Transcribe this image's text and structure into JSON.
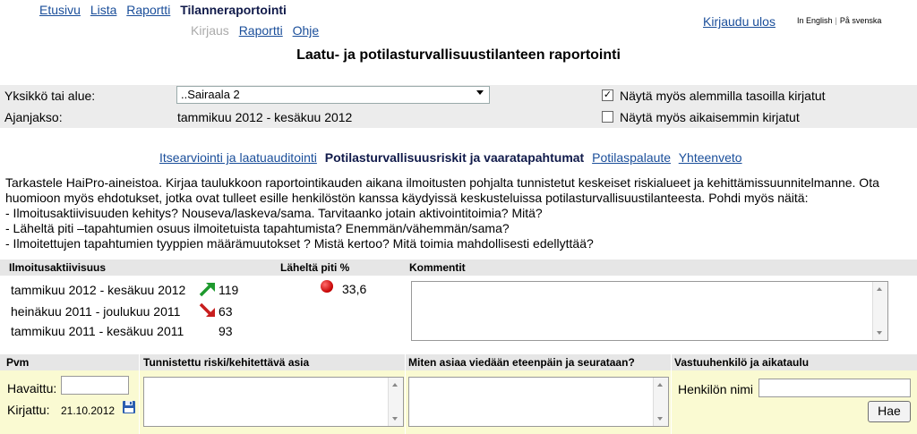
{
  "nav": {
    "primary": [
      "Etusivu",
      "Lista",
      "Raportti",
      "Tilanneraportointi"
    ],
    "secondary": [
      "Kirjaus",
      "Raportti",
      "Ohje"
    ],
    "logout": "Kirjaudu ulos",
    "lang_en": "In English",
    "lang_sep": "|",
    "lang_sv": "På svenska"
  },
  "page_title": "Laatu- ja potilasturvallisuustilanteen raportointi",
  "filters": {
    "unit_label": "Yksikkö tai alue:",
    "unit_value": "..Sairaala 2",
    "period_label": "Ajanjakso:",
    "period_value": "tammikuu 2012 - kesäkuu 2012",
    "show_lower_label": "Näytä myös alemmilla tasoilla kirjatut",
    "show_lower_checked": true,
    "show_earlier_label": "Näytä myös aikaisemmin kirjatut",
    "show_earlier_checked": false
  },
  "tabs": [
    "Itsearviointi ja laatuauditointi",
    "Potilasturvallisuusriskit ja vaaratapahtumat",
    "Potilaspalaute",
    "Yhteenveto"
  ],
  "intro": [
    "Tarkastele HaiPro-aineistoa. Kirjaa taulukkoon raportointikauden aikana ilmoitusten pohjalta tunnistetut keskeiset riskialueet ja kehittämissuunnitelmanne. Ota huomioon myös ehdotukset, jotka ovat tulleet esille henkilöstön kanssa käydyissä keskusteluissa potilasturvallisuustilanteesta. Pohdi myös näitä:",
    "- Ilmoitusaktiivisuuden kehitys? Nouseva/laskeva/sama. Tarvitaanko jotain aktivointitoimia? Mitä?",
    "- Läheltä piti –tapahtumien osuus ilmoitetuista tapahtumista? Enemmän/vähemmän/sama?",
    "- Ilmoitettujen tapahtumien tyyppien määrämuutokset ? Mistä kertoo? Mitä toimia mahdollisesti edellyttää?"
  ],
  "activity": {
    "header_activity": "Ilmoitusaktiivisuus",
    "header_nearmiss": "Läheltä piti %",
    "header_comments": "Kommentit",
    "rows": [
      {
        "period": "tammikuu 2012 - kesäkuu 2012",
        "trend": "up",
        "count": "119"
      },
      {
        "period": "heinäkuu 2011 - joulukuu 2011",
        "trend": "down",
        "count": "63"
      },
      {
        "period": "tammikuu 2011 - kesäkuu 2011",
        "trend": "none",
        "count": "93"
      }
    ],
    "nearmiss_value": "33,6",
    "nearmiss_color": "#d40000"
  },
  "risk_table": {
    "col_date": "Pvm",
    "col_risk": "Tunnistettu riski/kehitettävä asia",
    "col_followup": "Miten asiaa viedään eteenpäin ja seurataan?",
    "col_owner": "Vastuuhenkilö ja aikataulu",
    "observed_label": "Havaittu:",
    "recorded_label": "Kirjattu:",
    "recorded_value": "21.10.2012",
    "person_label": "Henkilön nimi",
    "search_button": "Hae"
  },
  "colors": {
    "link": "#1a4e9a",
    "arrow_up": "#1e9a2e",
    "arrow_down": "#c81e1e",
    "row_highlight": "#fafad2",
    "header_bg": "#e6e6e6"
  }
}
